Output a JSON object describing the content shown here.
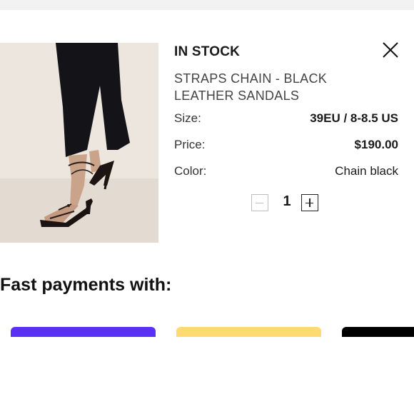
{
  "product": {
    "stock_status": "IN STOCK",
    "name": "STRAPS CHAIN - BLACK LEATHER SANDALS",
    "size_label": "Size:",
    "size_value": "39EU / 8-8.5 US",
    "price_label": "Price:",
    "price_value": "$190.00",
    "color_label": "Color:",
    "color_value": "Chain black",
    "quantity": "1"
  },
  "icons": {
    "close": "close-icon",
    "decrease": "minus-icon",
    "increase": "plus-icon"
  },
  "payments": {
    "title": "Fast payments with:",
    "buttons": [
      {
        "name": "payment-option-1",
        "color": "#5a31f4"
      },
      {
        "name": "payment-option-2",
        "color": "#ffd971"
      },
      {
        "name": "payment-option-3",
        "color": "#000000"
      }
    ]
  }
}
